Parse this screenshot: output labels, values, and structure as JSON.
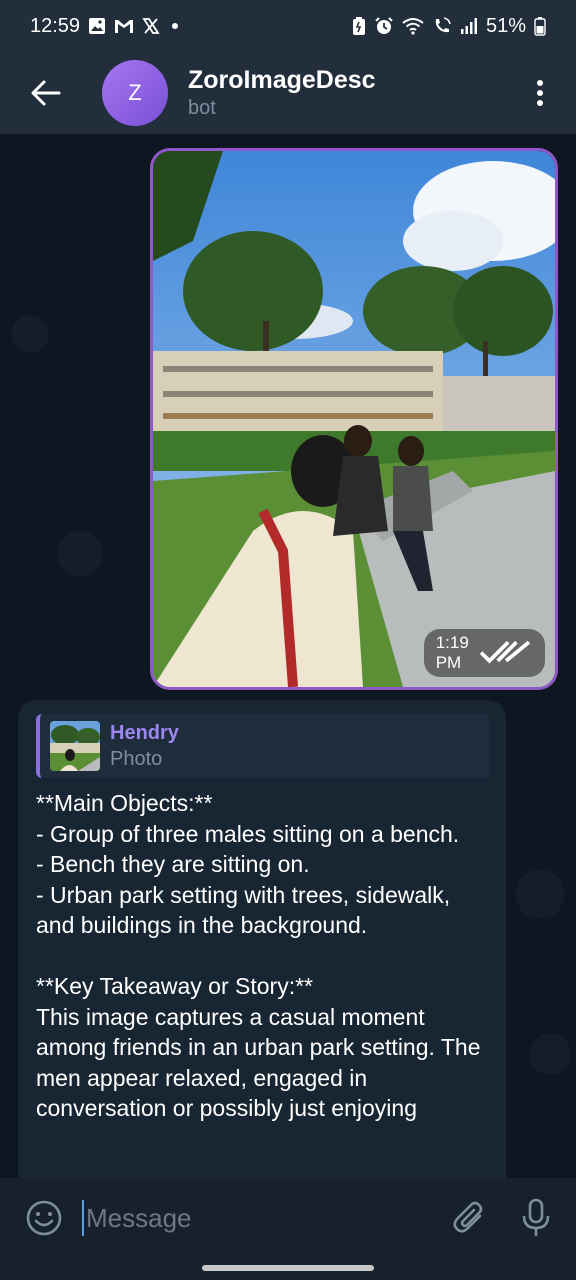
{
  "status_bar": {
    "time": "12:59",
    "battery": "51%",
    "left_icons": [
      "gallery-icon",
      "gmail-icon",
      "x-icon",
      "dot-icon"
    ],
    "right_icons": [
      "battery-saver-icon",
      "alarm-icon",
      "wifi-icon",
      "wifi-call-icon",
      "signal-icon",
      "battery-icon"
    ]
  },
  "header": {
    "avatar_letter": "Z",
    "title": "ZoroImageDesc",
    "subtitle": "bot",
    "back_icon": "arrow-left-icon",
    "menu_icon": "more-vertical-icon"
  },
  "photo_message": {
    "time": "1:19 PM",
    "status_icon": "double-check-icon",
    "border_color": "#8f58c9"
  },
  "text_message": {
    "reply_name": "Hendry",
    "reply_type": "Photo",
    "body": "**Main Objects:**\n- Group of three males sitting on a bench.\n- Bench they are sitting on.\n- Urban park setting with trees, sidewalk, and buildings in the background.\n\n**Key Takeaway or Story:**\nThis image captures a casual moment among friends in an urban park setting. The men appear relaxed, engaged in conversation or possibly just enjoying"
  },
  "composer": {
    "placeholder": "Message",
    "emoji_icon": "emoji-icon",
    "attach_icon": "paperclip-icon",
    "mic_icon": "microphone-icon"
  },
  "colors": {
    "background": "#0e1621",
    "header": "#232e3c",
    "bubble": "#182533",
    "accent": "#9c86f0"
  }
}
